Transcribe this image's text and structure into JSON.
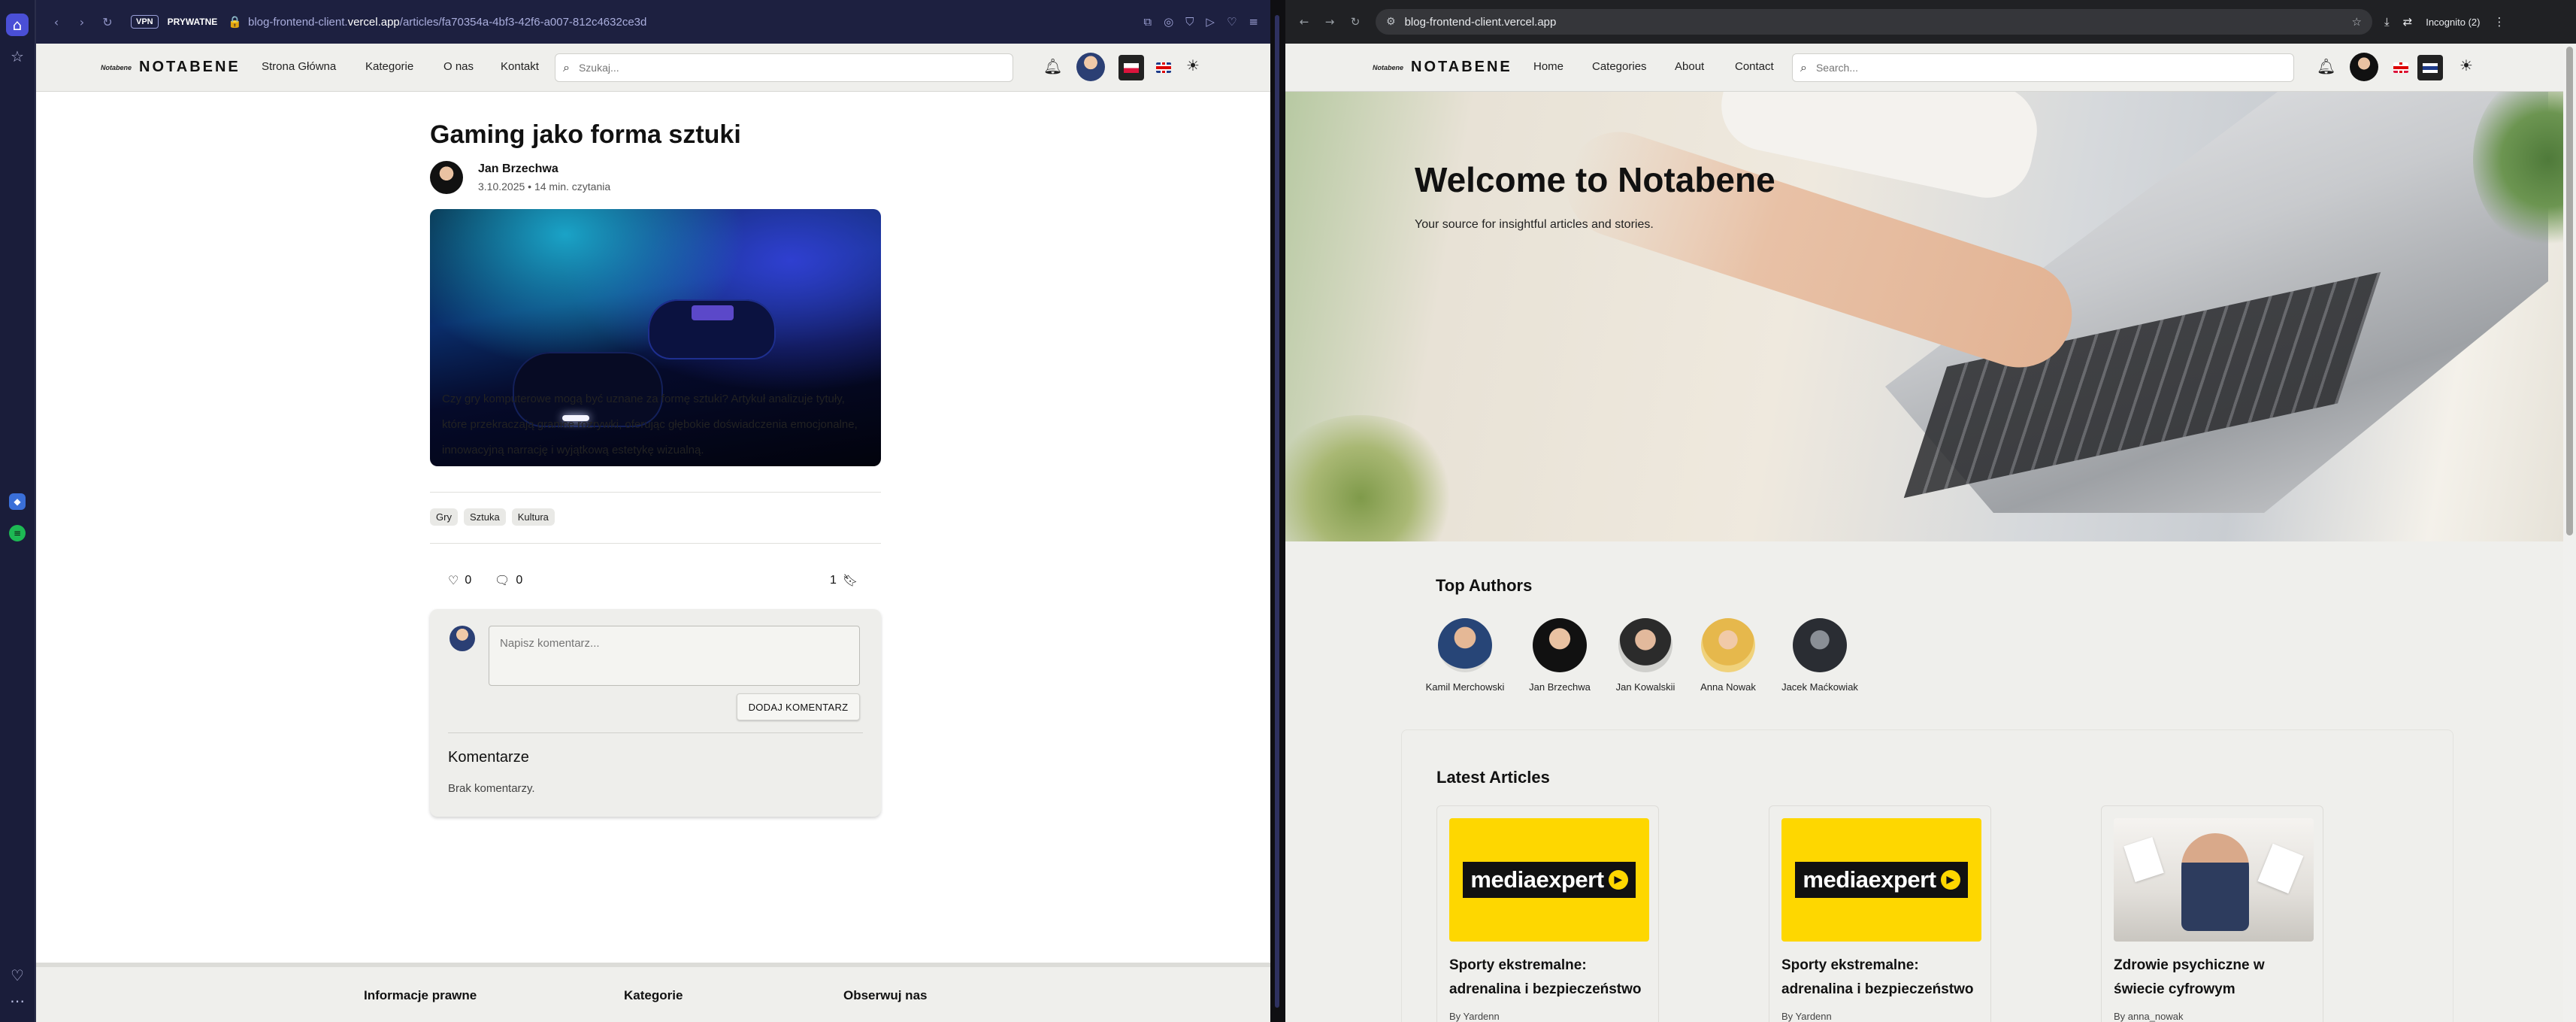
{
  "left_browser": {
    "vpn_badge": "VPN",
    "private_label": "PRYWATNE",
    "url_prefix": "blog-frontend-client.",
    "url_domain": "vercel.app",
    "url_path": "/articles/fa70354a-4bf3-42f6-a007-812c4632ce3d",
    "sidebar_icons": [
      "home-icon",
      "star-icon",
      "app-icon-1",
      "app-icon-2",
      "heart-icon",
      "more-icon"
    ]
  },
  "site_pl": {
    "logo_mark": "Notabene",
    "logo_word": "NOTABENE",
    "nav": [
      "Strona Główna",
      "Kategorie",
      "O nas",
      "Kontakt"
    ],
    "search_placeholder": "Szukaj..."
  },
  "article": {
    "title": "Gaming jako forma sztuki",
    "author": "Jan Brzechwa",
    "meta": "3.10.2025 • 14 min. czytania",
    "body": [
      "Czy gry komputerowe mogą być uznane za formę sztuki? Artykuł analizuje tytuły,",
      "które przekraczają granice rozrywki, oferując głębokie doświadczenia emocjonalne,",
      "innowacyjną narrację i wyjątkową estetykę wizualną."
    ],
    "tags": [
      "Gry",
      "Sztuka",
      "Kultura"
    ],
    "likes": "0",
    "comments": "0",
    "bookmarks": "1",
    "comment_placeholder": "Napisz komentarz...",
    "add_comment_button": "DODAJ KOMENTARZ",
    "comments_heading": "Komentarze",
    "no_comments": "Brak komentarzy."
  },
  "footer_pl": {
    "headings": [
      "Informacje prawne",
      "Kategorie",
      "Obserwuj nas"
    ]
  },
  "right_browser": {
    "url": "blog-frontend-client.vercel.app",
    "incognito_label": "Incognito (2)"
  },
  "site_en": {
    "logo_mark": "Notabene",
    "logo_word": "NOTABENE",
    "nav": [
      "Home",
      "Categories",
      "About",
      "Contact"
    ],
    "search_placeholder": "Search...",
    "hero_title": "Welcome to Notabene",
    "hero_subtitle": "Your source for insightful articles and stories.",
    "top_authors_heading": "Top Authors",
    "authors": [
      "Kamil Merchowski",
      "Jan Brzechwa",
      "Jan Kowalskii",
      "Anna Nowak",
      "Jacek Maćkowiak"
    ],
    "latest_heading": "Latest Articles",
    "articles": [
      {
        "brand": "mediaexpert",
        "title_l1": "Sporty ekstremalne:",
        "title_l2": "adrenalina i bezpieczeństwo",
        "by": "By Yardenn"
      },
      {
        "brand": "mediaexpert",
        "title_l1": "Sporty ekstremalne:",
        "title_l2": "adrenalina i bezpieczeństwo",
        "by": "By Yardenn"
      },
      {
        "brand": "",
        "title_l1": "Zdrowie psychiczne w",
        "title_l2": "świecie cyfrowym",
        "by": "By anna_nowak"
      }
    ]
  },
  "colors": {
    "accent_sidebar": "#4a4fd6",
    "media_expert_yellow": "#fed700",
    "page_bg": "#efefec"
  }
}
